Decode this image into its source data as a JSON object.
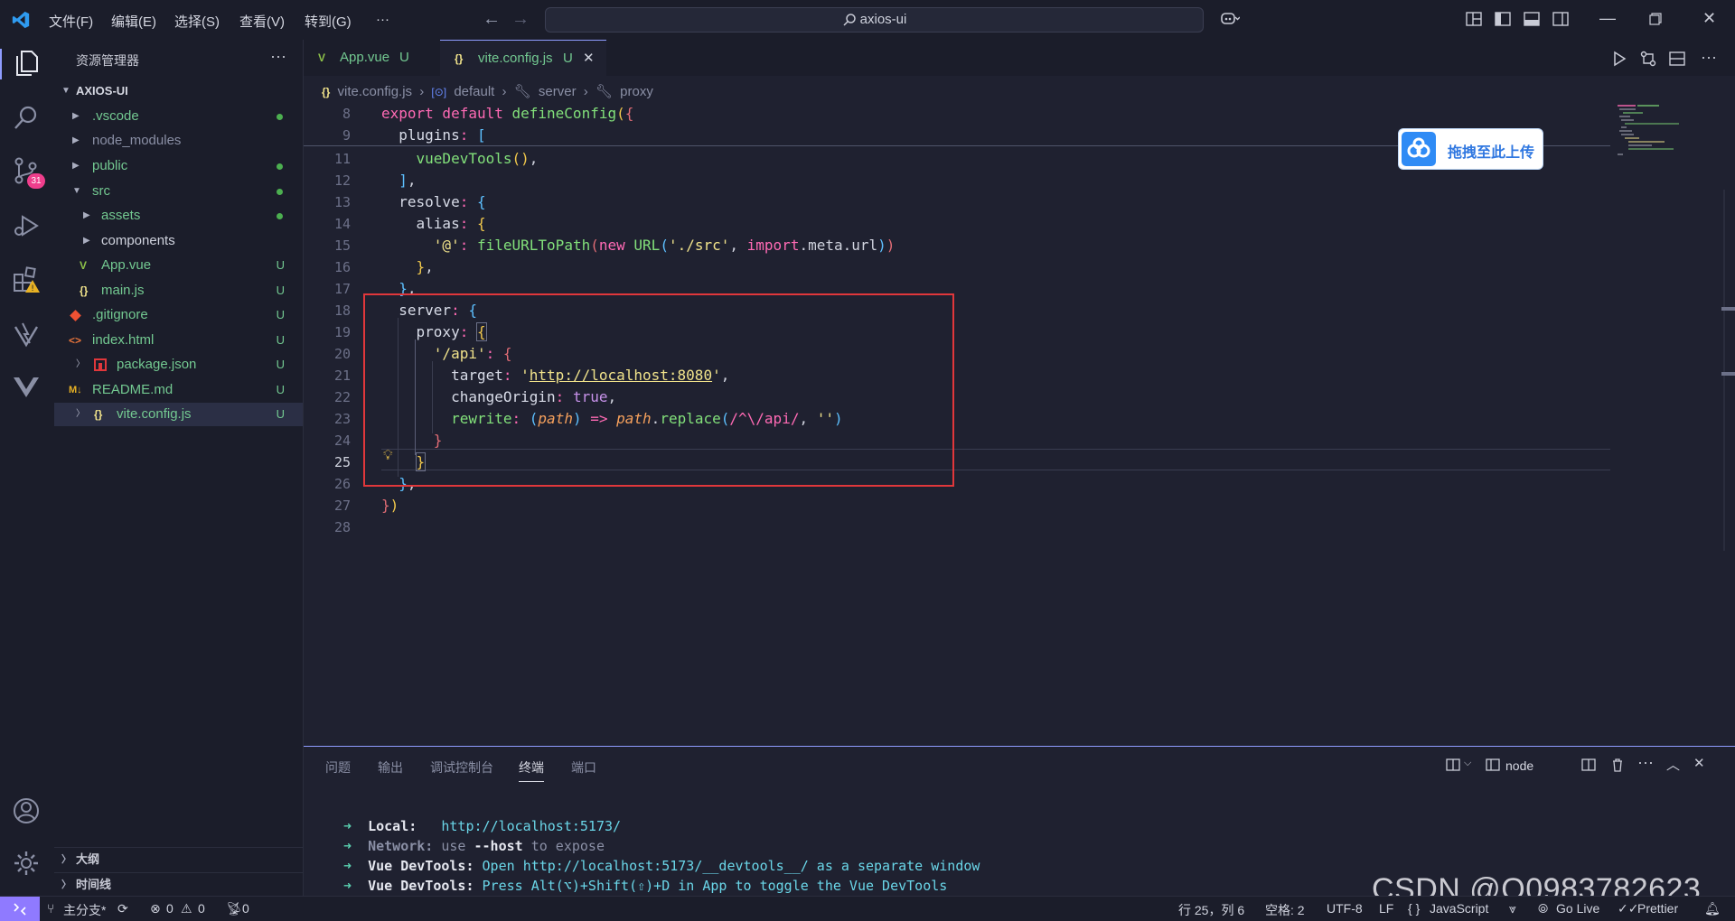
{
  "titlebar": {
    "menus": [
      "文件(F)",
      "编辑(E)",
      "选择(S)",
      "查看(V)",
      "转到(G)",
      "···"
    ],
    "search_text": "axios-ui"
  },
  "activity": {
    "source_control_badge": "31"
  },
  "sidebar": {
    "title": "资源管理器",
    "more": "···",
    "root": "AXIOS-UI",
    "items": [
      {
        "name": ".vscode",
        "status": "dot",
        "color": "#4caf50"
      },
      {
        "name": "node_modules",
        "status": ""
      },
      {
        "name": "public",
        "status": "dot"
      },
      {
        "name": "src",
        "status": "dot"
      },
      {
        "name": "assets",
        "status": "dot"
      },
      {
        "name": "components",
        "status": ""
      },
      {
        "name": "App.vue",
        "status": "U",
        "icon": "V"
      },
      {
        "name": "main.js",
        "status": "U",
        "icon": "{}"
      },
      {
        "name": ".gitignore",
        "status": "U"
      },
      {
        "name": "index.html",
        "status": "U",
        "icon": "<>"
      },
      {
        "name": "package.json",
        "status": "U"
      },
      {
        "name": "README.md",
        "status": "U",
        "icon": "M↓"
      },
      {
        "name": "vite.config.js",
        "status": "U",
        "icon": "{}"
      }
    ],
    "outline": "大纲",
    "timeline": "时间线"
  },
  "tabs": [
    {
      "label": "App.vue",
      "status": "U"
    },
    {
      "label": "vite.config.js",
      "status": "U",
      "close": "✕"
    }
  ],
  "breadcrumb": [
    "vite.config.js",
    "default",
    "server",
    "proxy"
  ],
  "editor": {
    "line_numbers": [
      "8",
      "9",
      "11",
      "12",
      "13",
      "14",
      "15",
      "16",
      "17",
      "18",
      "19",
      "20",
      "21",
      "22",
      "23",
      "24",
      "25",
      "26",
      "27",
      "28"
    ],
    "current_line": "25"
  },
  "baidu_overlay": {
    "label": "拖拽至此上传"
  },
  "panel": {
    "tabs": [
      "问题",
      "输出",
      "调试控制台",
      "终端",
      "端口"
    ],
    "active_tab": "终端",
    "terminal_name": "node"
  },
  "terminal": {
    "line1": {
      "label": "Local:",
      "url": "http://localhost:5173/"
    },
    "line2": {
      "label": "Network:",
      "pre": "use",
      "flag": "--host",
      "post": "to expose"
    },
    "line3": {
      "label": "Vue DevTools:",
      "pre": "Open",
      "url": "http://localhost:5173/__devtools__/",
      "post": "as a separate window"
    },
    "line4": {
      "label": "Vue DevTools:",
      "text": "Press Alt(⌥)+Shift(⇧)+D in App to toggle the Vue DevTools"
    }
  },
  "statusbar": {
    "branch": "主分支*",
    "errors": "0",
    "warnings": "0",
    "ports": "0",
    "position": "行 25，列 6",
    "spaces": "空格: 2",
    "encoding": "UTF-8",
    "eol": "LF",
    "language": "JavaScript",
    "golive": "Go Live",
    "prettier": "Prettier"
  },
  "watermark": "CSDN @Q0983782623",
  "colors": {
    "accent": "#8f9cff",
    "untracked": "#73c991",
    "highlight_box": "#e0373b"
  }
}
